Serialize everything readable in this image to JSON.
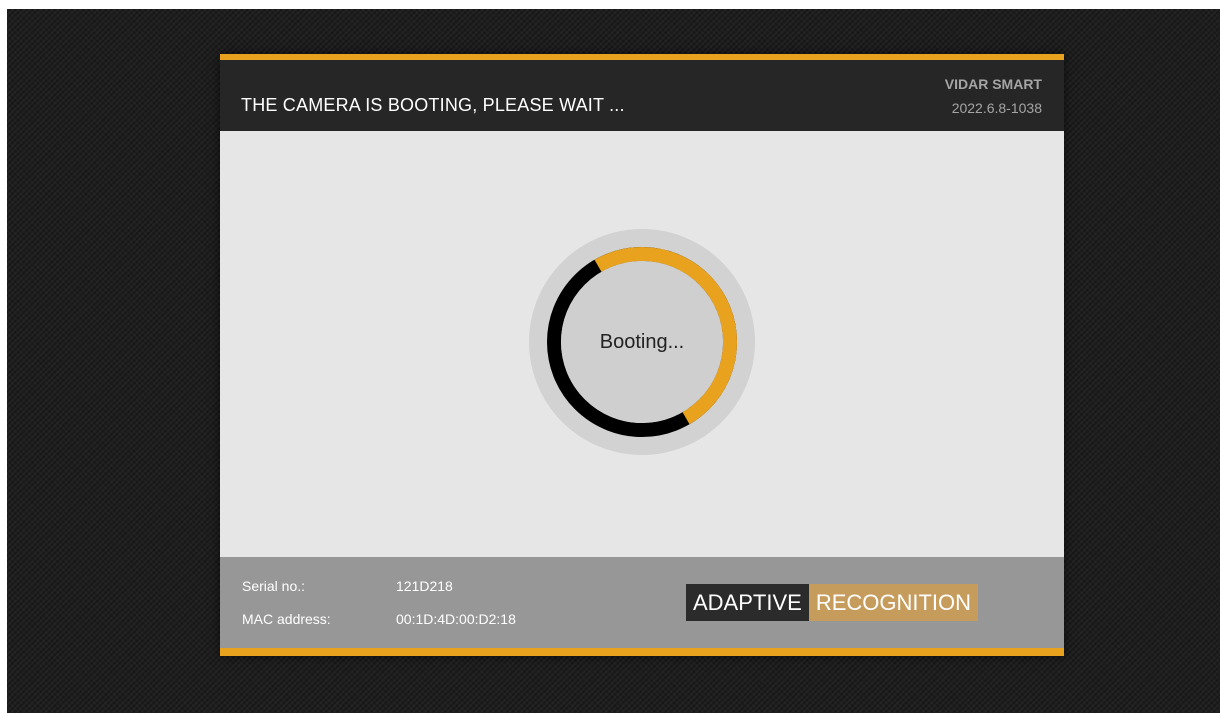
{
  "header": {
    "title": "THE CAMERA IS BOOTING, PLEASE WAIT ...",
    "product_name": "VIDAR SMART",
    "version": "2022.6.8-1038"
  },
  "boot": {
    "status_text": "Booting...",
    "progress_fraction": 0.5
  },
  "footer": {
    "serial_label": "Serial no.:",
    "serial_value": "121D218",
    "mac_label": "MAC address:",
    "mac_value": "00:1D:4D:00:D2:18"
  },
  "logo": {
    "word1": "ADAPTIVE",
    "word2": "RECOGNITION"
  },
  "colors": {
    "accent": "#e8a21e",
    "header_bg": "#262626",
    "body_bg": "#e6e6e6",
    "footer_bg": "#979797",
    "logo_dark": "#2b2b2b",
    "logo_gold": "#c69c5c"
  }
}
